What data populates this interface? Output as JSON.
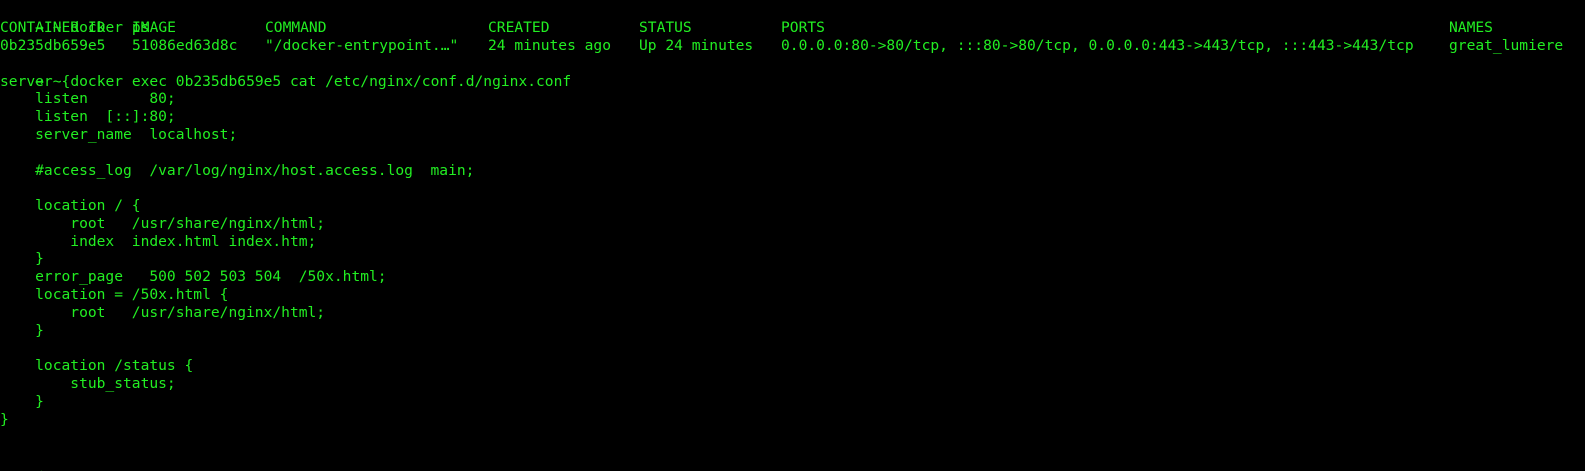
{
  "terminal": {
    "text_color": "#22ee22",
    "background_color": "#000000",
    "prompt": {
      "arrow": "→",
      "cwd": "~"
    },
    "commands": {
      "ps": "docker ps",
      "exec": "docker exec 0b235db659e5 cat /etc/nginx/conf.d/nginx.conf"
    },
    "ps_headers": {
      "container_id": "CONTAINER ID",
      "image": "IMAGE",
      "command": "COMMAND",
      "created": "CREATED",
      "status": "STATUS",
      "ports": "PORTS",
      "names": "NAMES"
    },
    "ps_row": {
      "container_id": "0b235db659e5",
      "image": "51086ed63d8c",
      "command": "\"/docker-entrypoint.…\"",
      "created": "24 minutes ago",
      "status": "Up 24 minutes",
      "ports": "0.0.0.0:80->80/tcp, :::80->80/tcp, 0.0.0.0:443->443/tcp, :::443->443/tcp",
      "names": "great_lumiere"
    },
    "config": {
      "server_open": "server {",
      "listen_80": "    listen       80;",
      "listen_ipv6": "    listen  [::]:80;",
      "server_name": "    server_name  localhost;",
      "access_log": "    #access_log  /var/log/nginx/host.access.log  main;",
      "location_root_open": "    location / {",
      "root_html": "        root   /usr/share/nginx/html;",
      "index": "        index  index.html index.htm;",
      "location_root_close": "    }",
      "error_page": "    error_page   500 502 503 504  /50x.html;",
      "location_50x_open": "    location = /50x.html {",
      "root_html_50x": "        root   /usr/share/nginx/html;",
      "location_50x_close": "    }",
      "location_status_open": "    location /status {",
      "stub_status": "        stub_status;",
      "location_status_close": "    }",
      "server_close": "}"
    }
  }
}
